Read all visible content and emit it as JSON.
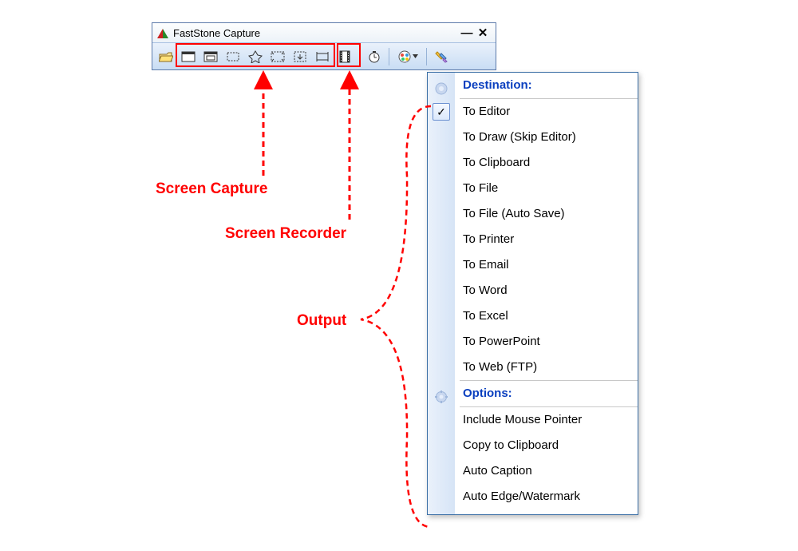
{
  "window": {
    "title": "FastStone Capture",
    "minimize": "—",
    "close": "✕"
  },
  "toolbar": {
    "open": "open-file-icon",
    "captures": [
      "capture-window-icon",
      "capture-object-icon",
      "capture-rect-icon",
      "capture-freehand-icon",
      "capture-fullscreen-icon",
      "capture-scrolling-icon",
      "capture-fixed-icon"
    ],
    "recorder": "screen-recorder-icon",
    "delay": "delay-timer-icon",
    "output": "output-destination-icon",
    "settings": "settings-icon"
  },
  "dropdown": {
    "section1_title": "Destination:",
    "items1": [
      "To Editor",
      "To Draw (Skip Editor)",
      "To Clipboard",
      "To File",
      "To File (Auto Save)",
      "To Printer",
      "To Email",
      "To Word",
      "To Excel",
      "To PowerPoint",
      "To Web (FTP)"
    ],
    "checked_index": 0,
    "section2_title": "Options:",
    "items2": [
      "Include Mouse Pointer",
      "Copy to Clipboard",
      "Auto Caption",
      "Auto Edge/Watermark"
    ]
  },
  "annotations": {
    "capture": "Screen Capture",
    "recorder": "Screen Recorder",
    "output": "Output"
  }
}
